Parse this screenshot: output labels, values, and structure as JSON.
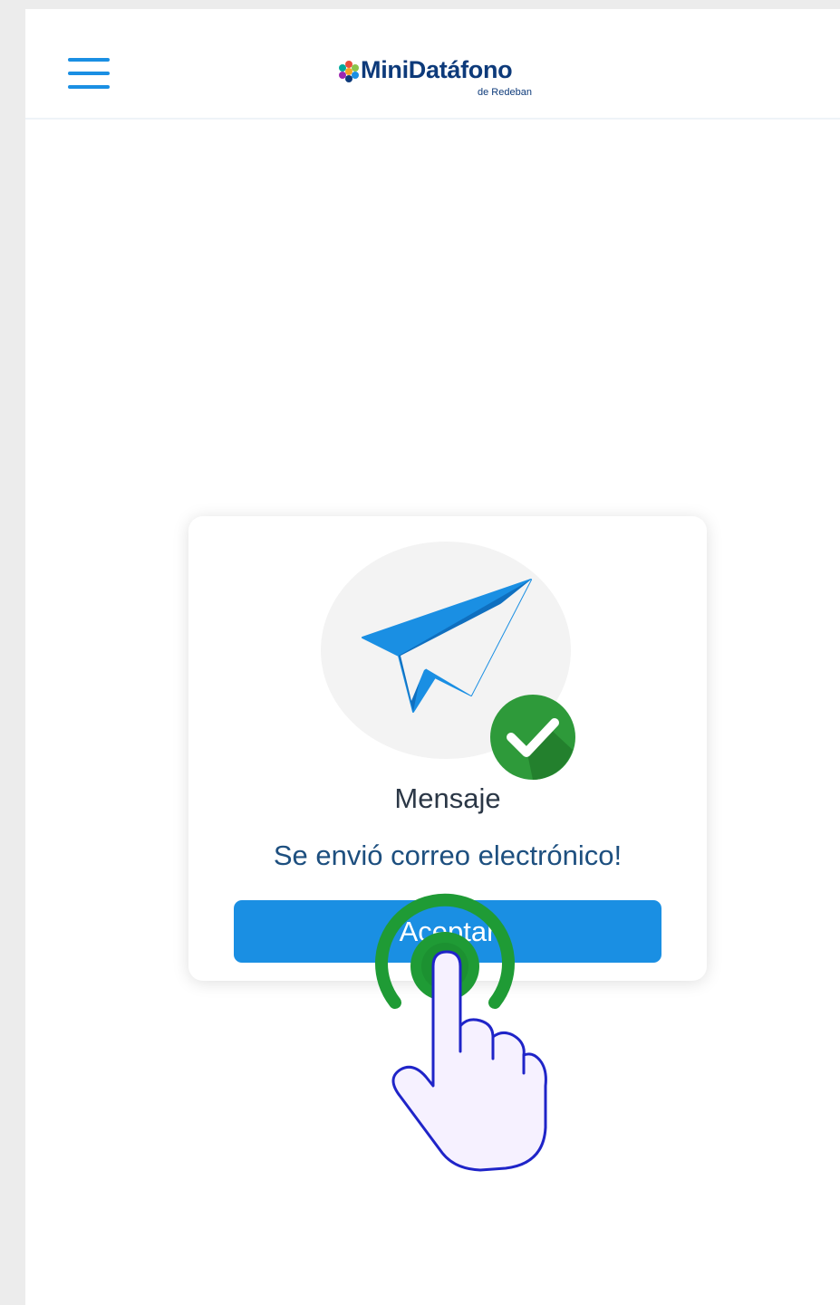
{
  "app": {
    "brand_name": "MiniDatáfono",
    "brand_sub": "de Redeban"
  },
  "icons": {
    "menu": "hamburger-menu-icon",
    "dialog_icon": "paper-plane-icon",
    "status_icon": "check-circle-icon",
    "pointer": "tap-hand-icon"
  },
  "dialog": {
    "title": "Mensaje",
    "message": "Se envió correo electrónico!",
    "accept_label": "Aceptar"
  },
  "colors": {
    "accent": "#1a8fe3",
    "brand_text": "#0d3a7a",
    "success": "#2e9a3a",
    "tap_ring": "#1f9b35"
  }
}
